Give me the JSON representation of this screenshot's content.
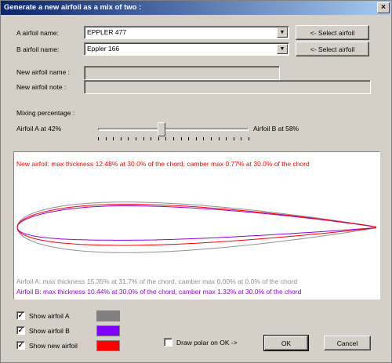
{
  "window": {
    "title": "Generate a new airfoil as a mix of two :",
    "close_glyph": "×"
  },
  "form": {
    "a_label": "A airfoil name:",
    "a_value": "EPPLER 477",
    "b_label": "B airfoil name:",
    "b_value": "Eppler 166",
    "select_label": "<- Select airfoil",
    "new_name_label": "New airfoil name :",
    "new_name_value": "",
    "new_note_label": "New airfoil note :",
    "new_note_value": "",
    "dropdown_glyph": "▼"
  },
  "mixing": {
    "heading": "Mixing percentage :",
    "left_label": "Airfoil A at 42%",
    "right_label": "Airfoil B at 58%",
    "value_percent": 42
  },
  "plot": {
    "new_info": "New airfoil: max thickness 12.48% at 30.0% of the chord, camber max 0.77% at 30.0% of the chord",
    "a_info": "Airfoil A: max thickness 15.35% at 31.7% of the chord, camber max 0.00% at 0.0% of the chord",
    "b_info": "Airfoil B: max thickness 10.44% at 30.0% of the chord, camber max 1.32% at 30.0% of the chord",
    "colors": {
      "a": "#909090",
      "b": "#9000e0",
      "new": "#ff0000"
    },
    "airfoils": [
      {
        "name": "a",
        "thickness": 15.35,
        "thickness_pos": 31.7,
        "camber": 0.0,
        "camber_pos": 0.0
      },
      {
        "name": "b",
        "thickness": 10.44,
        "thickness_pos": 30.0,
        "camber": 1.32,
        "camber_pos": 30.0
      },
      {
        "name": "new",
        "thickness": 12.48,
        "thickness_pos": 30.0,
        "camber": 0.77,
        "camber_pos": 30.0
      }
    ]
  },
  "options": {
    "show_a_label": "Show airfoil A",
    "show_a_checked": true,
    "show_b_label": "Show airfoil B",
    "show_b_checked": true,
    "show_new_label": "Show new airfoil",
    "show_new_checked": true,
    "draw_polar_label": "Draw polar on OK ->",
    "draw_polar_checked": false,
    "check_glyph": "✓",
    "swatch_a": "#808080",
    "swatch_b": "#8000ff",
    "swatch_new": "#ff0000"
  },
  "buttons": {
    "ok_label": "OK",
    "cancel_label": "Cancel"
  }
}
